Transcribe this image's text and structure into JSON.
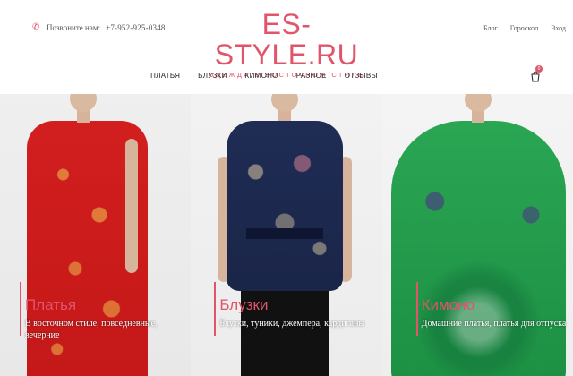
{
  "header": {
    "phone_label": "Позвоните нам:",
    "phone_number": "+7-952-925-0348",
    "logo_title": "ES-STYLE.RU",
    "logo_subtitle": "ОДЕЖДА В ВОСТОЧНОМ СТИЛЕ",
    "top_links": [
      "Блог",
      "Гороскоп",
      "Вход"
    ],
    "cart_count": "0"
  },
  "nav": {
    "items": [
      "ПЛАТЬЯ",
      "БЛУЗКИ",
      "КИМОНО",
      "РАЗНОЕ",
      "ОТЗЫВЫ"
    ]
  },
  "panels": [
    {
      "title": "Платья",
      "desc": "В восточном стиле, повседневные, вечерние"
    },
    {
      "title": "Блузки",
      "desc": "Блузки, туники, джемпера, кардиганы"
    },
    {
      "title": "Кимоно",
      "desc": "Домашние платья, платья для отпуска"
    }
  ],
  "colors": {
    "accent": "#e0556a"
  }
}
